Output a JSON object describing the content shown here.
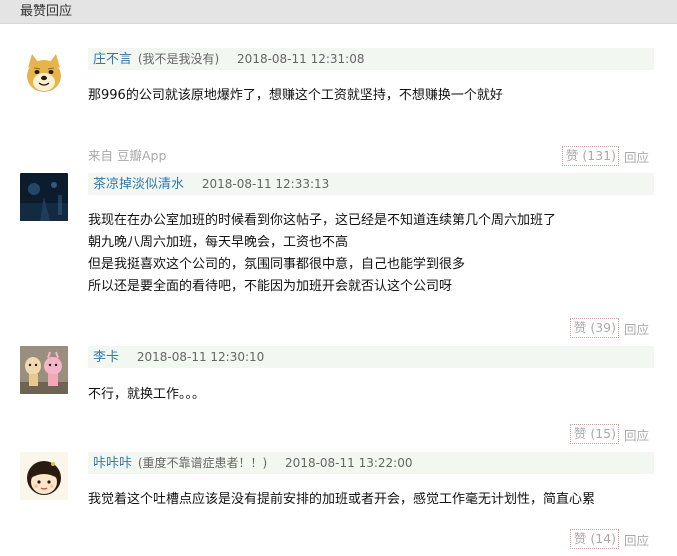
{
  "section": {
    "title": "最赞回应"
  },
  "comments": [
    {
      "author": "庄不言",
      "status": "(我不是我没有)",
      "time": "2018-08-11 12:31:08",
      "lines": [
        "那996的公司就该原地爆炸了，想赚这个工资就坚持，不想赚换一个就好"
      ],
      "source": "来自 豆瓣App",
      "vote_label": "赞 (131)",
      "reply_label": "回应",
      "avatar_icon": "shiba-doge-avatar"
    },
    {
      "author": "茶凉掉淡似清水",
      "status": "",
      "time": "2018-08-11 12:33:13",
      "lines": [
        "我现在在办公室加班的时候看到你这帖子，这已经是不知道连续第几个周六加班了",
        "朝九晚八周六加班，每天早晚会，工资也不高",
        "但是我挺喜欢这个公司的，氛围同事都很中意，自己也能学到很多",
        "所以还是要全面的看待吧，不能因为加班开会就否认这个公司呀"
      ],
      "source": "",
      "vote_label": "赞 (39)",
      "reply_label": "回应",
      "avatar_icon": "dark-night-avatar"
    },
    {
      "author": "李卡",
      "status": "",
      "time": "2018-08-11 12:30:10",
      "lines": [
        "不行，就换工作。。。"
      ],
      "source": "",
      "vote_label": "赞 (15)",
      "reply_label": "回应",
      "avatar_icon": "toys-photo-avatar"
    },
    {
      "author": "咔咔咔",
      "status": "(重度不靠谱症患者！！)",
      "time": "2018-08-11 13:22:00",
      "lines": [
        "我觉着这个吐槽点应该是没有提前安排的加班或者开会，感觉工作毫无计划性，简直心累"
      ],
      "source": "",
      "vote_label": "赞 (14)",
      "reply_label": "回应",
      "avatar_icon": "cartoon-girl-avatar"
    }
  ],
  "colors": {
    "author_link": "#3377aa",
    "meta_bar_bg": "#f2f7f1",
    "header_bg": "#e4e4e4",
    "muted_text": "#aaaaaa",
    "vote_border": "#dd9999"
  }
}
